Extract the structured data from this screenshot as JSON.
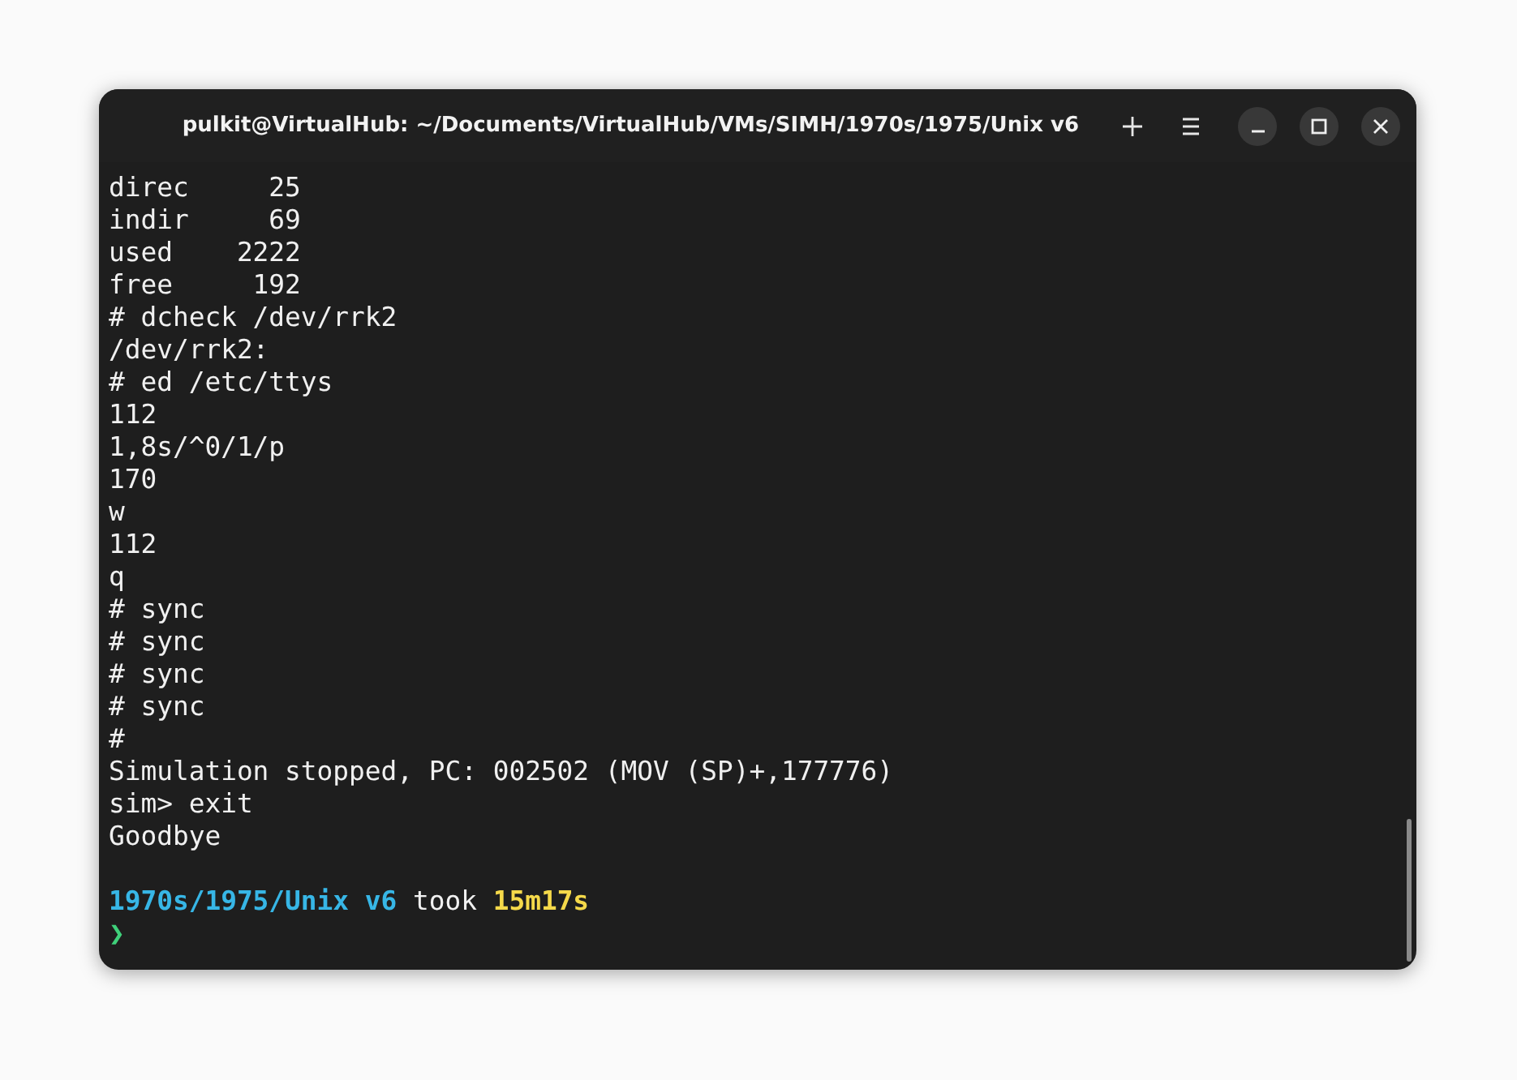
{
  "window": {
    "title": "pulkit@VirtualHub: ~/Documents/VirtualHub/VMs/SIMH/1970s/1975/Unix v6"
  },
  "terminal": {
    "lines": [
      {
        "kind": "output",
        "text": "direc     25"
      },
      {
        "kind": "output",
        "text": "indir     69"
      },
      {
        "kind": "output",
        "text": "used    2222"
      },
      {
        "kind": "output",
        "text": "free     192"
      },
      {
        "kind": "output",
        "text": "# dcheck /dev/rrk2"
      },
      {
        "kind": "output",
        "text": "/dev/rrk2:"
      },
      {
        "kind": "output",
        "text": "# ed /etc/ttys"
      },
      {
        "kind": "output",
        "text": "112"
      },
      {
        "kind": "output",
        "text": "1,8s/^0/1/p"
      },
      {
        "kind": "output",
        "text": "170"
      },
      {
        "kind": "output",
        "text": "w"
      },
      {
        "kind": "output",
        "text": "112"
      },
      {
        "kind": "output",
        "text": "q"
      },
      {
        "kind": "output",
        "text": "# sync"
      },
      {
        "kind": "output",
        "text": "# sync"
      },
      {
        "kind": "output",
        "text": "# sync"
      },
      {
        "kind": "output",
        "text": "# sync"
      },
      {
        "kind": "output",
        "text": "#"
      },
      {
        "kind": "output",
        "text": "Simulation stopped, PC: 002502 (MOV (SP)+,177776)"
      },
      {
        "kind": "output",
        "text": "sim> exit"
      },
      {
        "kind": "output",
        "text": "Goodbye"
      },
      {
        "kind": "blank"
      },
      {
        "kind": "status",
        "segments": [
          {
            "kind": "path",
            "text": "1970s/1975/Unix v6"
          },
          {
            "kind": "plain",
            "text": " took "
          },
          {
            "kind": "duration",
            "text": "15m17s"
          }
        ]
      },
      {
        "kind": "prompt",
        "text": "❯"
      }
    ]
  }
}
